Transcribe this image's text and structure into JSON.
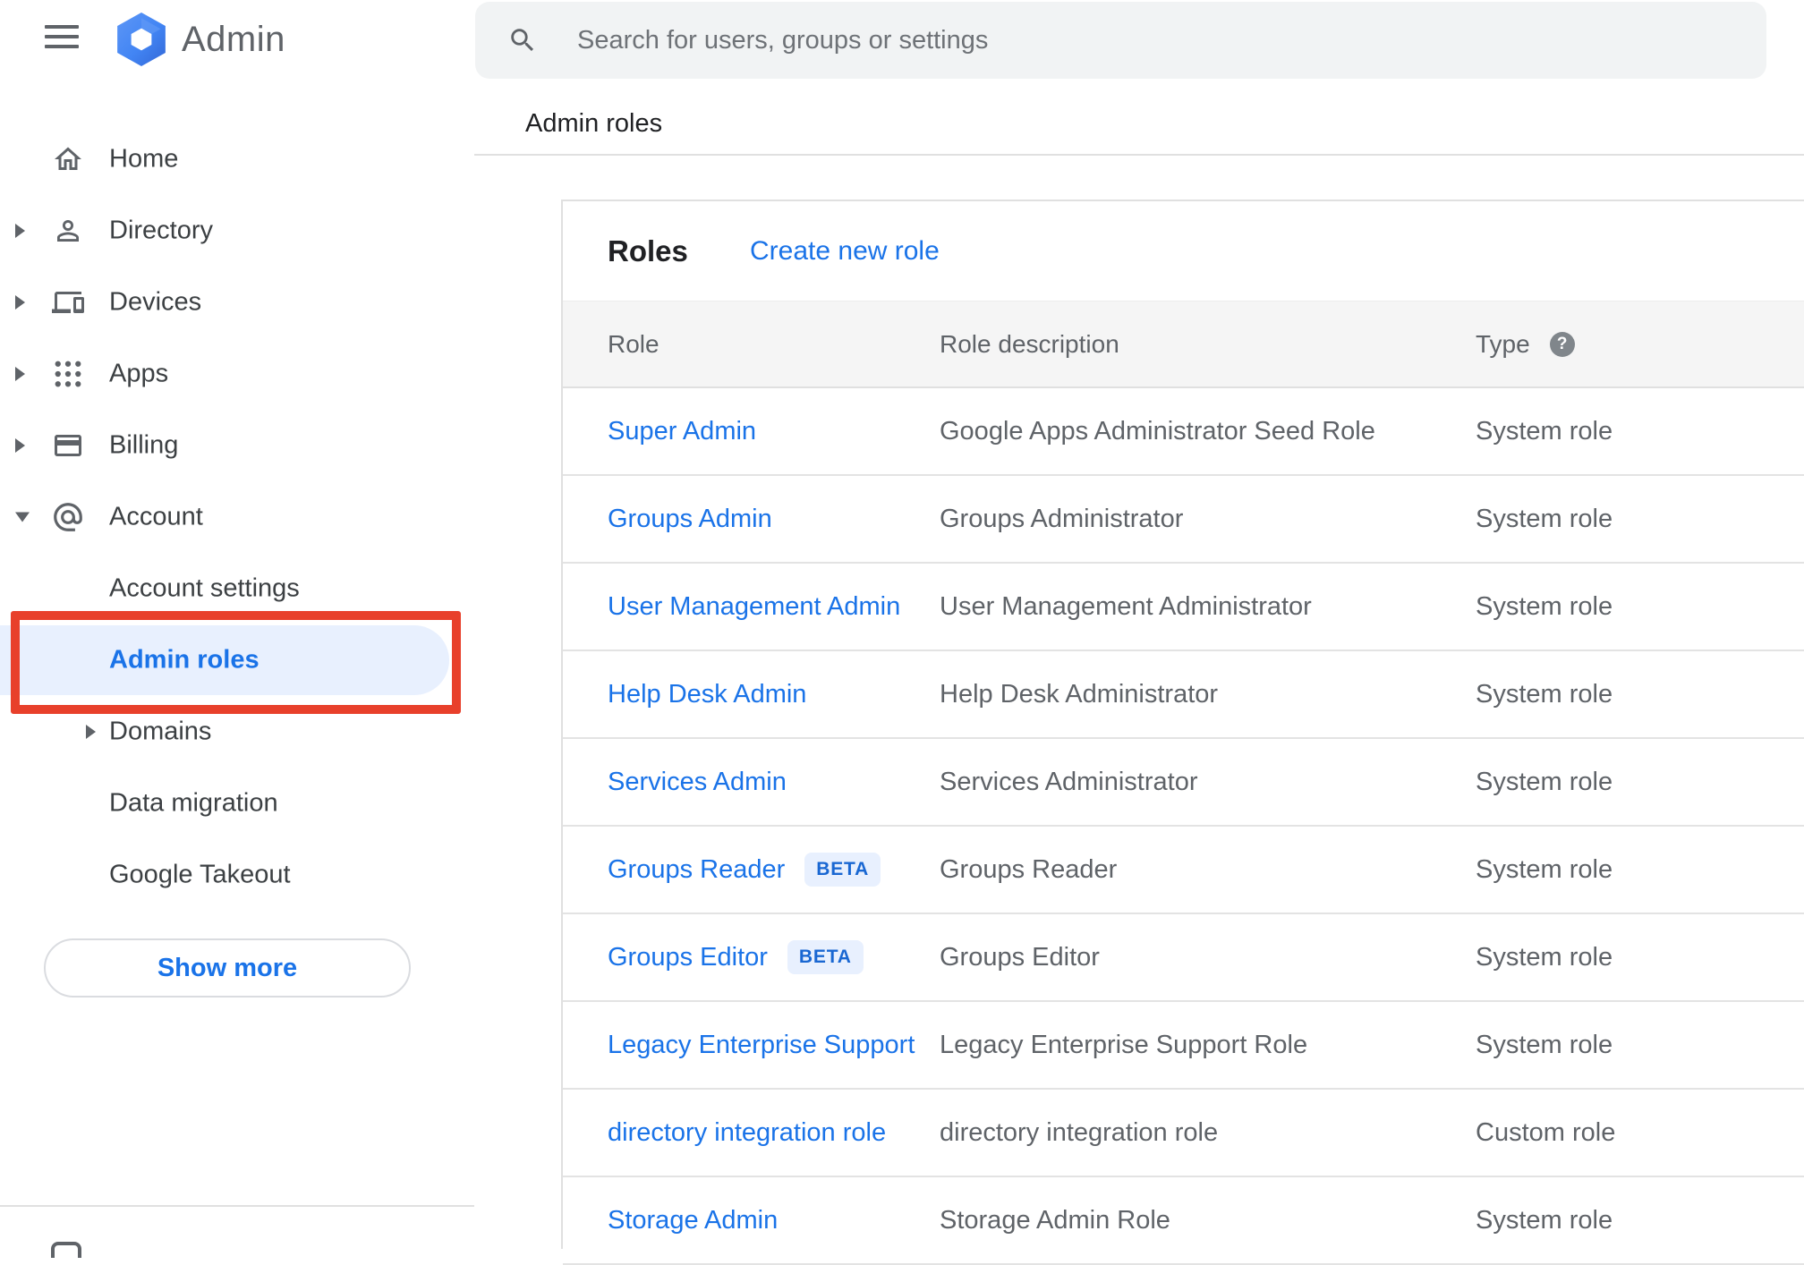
{
  "app": {
    "title": "Admin"
  },
  "search": {
    "placeholder": "Search for users, groups or settings"
  },
  "breadcrumb": "Admin roles",
  "sidebar": {
    "show_more_label": "Show more",
    "nav": [
      {
        "id": "home",
        "label": "Home",
        "icon": "home",
        "caret": "none",
        "indent": 0
      },
      {
        "id": "directory",
        "label": "Directory",
        "icon": "person",
        "caret": "right",
        "indent": 0
      },
      {
        "id": "devices",
        "label": "Devices",
        "icon": "devices",
        "caret": "right",
        "indent": 0
      },
      {
        "id": "apps",
        "label": "Apps",
        "icon": "apps",
        "caret": "right",
        "indent": 0
      },
      {
        "id": "billing",
        "label": "Billing",
        "icon": "card",
        "caret": "right",
        "indent": 0
      },
      {
        "id": "account",
        "label": "Account",
        "icon": "at",
        "caret": "down",
        "indent": 0
      },
      {
        "id": "account-settings",
        "label": "Account settings",
        "icon": null,
        "caret": "none",
        "indent": 1
      },
      {
        "id": "admin-roles",
        "label": "Admin roles",
        "icon": null,
        "caret": "none",
        "indent": 1,
        "active": true
      },
      {
        "id": "domains",
        "label": "Domains",
        "icon": null,
        "caret": "right",
        "indent": 2
      },
      {
        "id": "data-migration",
        "label": "Data migration",
        "icon": null,
        "caret": "none",
        "indent": 1
      },
      {
        "id": "google-takeout",
        "label": "Google Takeout",
        "icon": null,
        "caret": "none",
        "indent": 1
      }
    ]
  },
  "roles_panel": {
    "title": "Roles",
    "create_link": "Create new role",
    "columns": [
      "Role",
      "Role description",
      "Type"
    ],
    "help_glyph": "?",
    "beta_label": "BETA",
    "rows": [
      {
        "role": "Super Admin",
        "beta": false,
        "description": "Google Apps Administrator Seed Role",
        "type": "System role"
      },
      {
        "role": "Groups Admin",
        "beta": false,
        "description": "Groups Administrator",
        "type": "System role"
      },
      {
        "role": "User Management Admin",
        "beta": false,
        "description": "User Management Administrator",
        "type": "System role"
      },
      {
        "role": "Help Desk Admin",
        "beta": false,
        "description": "Help Desk Administrator",
        "type": "System role"
      },
      {
        "role": "Services Admin",
        "beta": false,
        "description": "Services Administrator",
        "type": "System role"
      },
      {
        "role": "Groups Reader",
        "beta": true,
        "description": "Groups Reader",
        "type": "System role"
      },
      {
        "role": "Groups Editor",
        "beta": true,
        "description": "Groups Editor",
        "type": "System role"
      },
      {
        "role": "Legacy Enterprise Support",
        "beta": false,
        "description": "Legacy Enterprise Support Role",
        "type": "System role"
      },
      {
        "role": "directory integration role",
        "beta": false,
        "description": "directory integration role",
        "type": "Custom role"
      },
      {
        "role": "Storage Admin",
        "beta": false,
        "description": "Storage Admin Role",
        "type": "System role"
      }
    ]
  },
  "colors": {
    "accent": "#1a73e8",
    "active_item_bg": "#e8f0fe",
    "annotation_red": "#e8402b",
    "badge_bg": "#e8f0fe",
    "badge_text": "#1967d2",
    "logo_blue": "#4285f4",
    "header_band_bg": "#f5f5f5"
  }
}
